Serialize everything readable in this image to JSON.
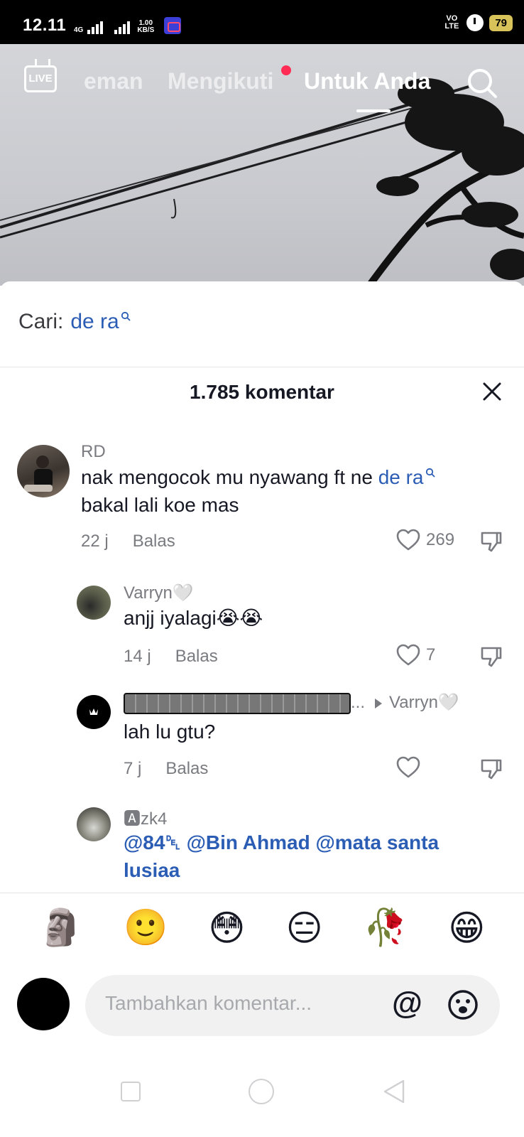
{
  "status_bar": {
    "time": "12.11",
    "net_type": "4G",
    "speed_value": "1.00",
    "speed_unit": "KB/S",
    "volte": "VO LTE",
    "battery": "79"
  },
  "top_nav": {
    "live_label": "LIVE",
    "tabs": [
      "eman",
      "Mengikuti",
      "Untuk Anda"
    ],
    "active_tab": "Untuk Anda"
  },
  "search": {
    "prefix": "Cari:",
    "keyword": "de ra"
  },
  "comments_header": {
    "title": "1.785 komentar"
  },
  "comments": [
    {
      "author": "RD",
      "text_before": "nak mengocok mu nyawang ft ne ",
      "keyword": "de ra",
      "text_after": "bakal lali koe mas",
      "time": "22 j",
      "reply_label": "Balas",
      "likes": "269"
    },
    {
      "author": "Varryn🤍",
      "text": "anjj iyalagi😭😭",
      "time": "14 j",
      "reply_label": "Balas",
      "likes": "7"
    },
    {
      "author_suffix": "...",
      "reply_to": "Varryn🤍",
      "text": "lah lu gtu?",
      "time": "7 j",
      "reply_label": "Balas",
      "likes": ""
    },
    {
      "author": "🅰zk4",
      "mentions": "@84␡ @Bin Ahmad @mata santa",
      "mentions_line2": "lusiaa"
    }
  ],
  "emoji_bar": [
    "🗿",
    "🙂",
    "😳",
    "😑",
    "🥀",
    "😁"
  ],
  "composer": {
    "placeholder": "Tambahkan komentar...",
    "at_symbol": "@"
  },
  "colors": {
    "keyword_blue": "#2b5db5",
    "notification_red": "#fe2c55",
    "muted_text": "#7a7b80"
  }
}
